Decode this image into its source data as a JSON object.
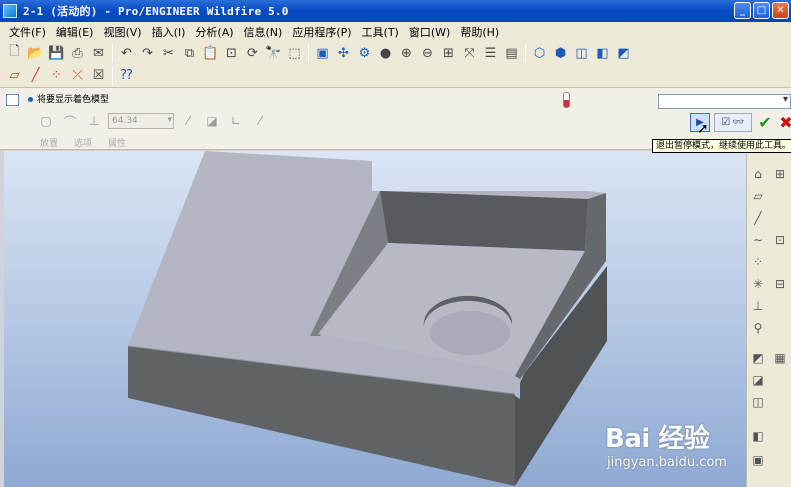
{
  "window": {
    "title": "2-1 (活动的) - Pro/ENGINEER Wildfire 5.0",
    "minimize_icon": "minimize-icon",
    "maximize_icon": "maximize-icon",
    "close_icon": "close-icon"
  },
  "menu": {
    "items": [
      "文件(F)",
      "编辑(E)",
      "视图(V)",
      "插入(I)",
      "分析(A)",
      "信息(N)",
      "应用程序(P)",
      "工具(T)",
      "窗口(W)",
      "帮助(H)"
    ]
  },
  "toolbar1": {
    "icons": [
      "new-icon",
      "open-icon",
      "save-icon",
      "print-icon",
      "email-icon",
      "undo-icon",
      "redo-icon",
      "cut-icon",
      "copy-icon",
      "paste-icon",
      "paste-special-icon",
      "regenerate-icon",
      "find-icon",
      "select-box-icon",
      "redraw-icon",
      "spin-center-icon",
      "orient-icon",
      "saved-views-icon",
      "zoom-in-icon",
      "zoom-out-icon",
      "refit-icon",
      "reorient-icon",
      "layers-icon",
      "view-manager-icon",
      "display-style-icon"
    ]
  },
  "toolbar2": {
    "icons": [
      "datum-plane-display-icon",
      "datum-axis-display-icon",
      "datum-point-display-icon",
      "csys-display-icon",
      "annotation-display-icon",
      "whats-this-icon"
    ]
  },
  "dashboard": {
    "title": "将要显示着色模型",
    "depth_value": "64.34",
    "tabs": [
      "放置",
      "选项",
      "属性"
    ],
    "tooltip": "退出暂停模式，继续使用此工具。"
  },
  "watermark": {
    "logo_text": "Bai 经验",
    "url": "jingyan.baidu.com"
  },
  "colors": {
    "title_bar": "#0a4cc6",
    "model_top": "#b3b6c2",
    "model_side": "#5f6366",
    "ok_green": "#1c9a1c",
    "cancel_red": "#cc1111"
  }
}
